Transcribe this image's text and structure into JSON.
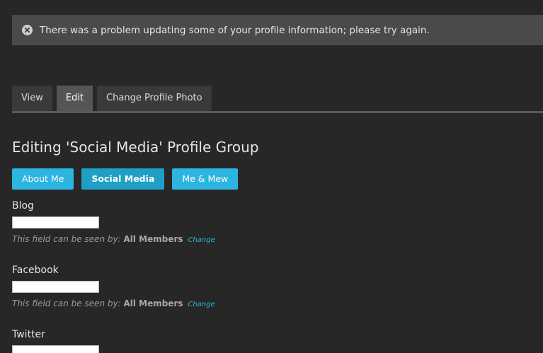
{
  "notice": {
    "message": "There was a problem updating some of your profile information; please try again.",
    "icon": "close-circle-icon"
  },
  "tabs": [
    {
      "label": "View",
      "active": false
    },
    {
      "label": "Edit",
      "active": true
    },
    {
      "label": "Change Profile Photo",
      "active": false
    }
  ],
  "heading": "Editing 'Social Media' Profile Group",
  "groups": [
    {
      "label": "About Me",
      "current": false
    },
    {
      "label": "Social Media",
      "current": true
    },
    {
      "label": "Me & Mew",
      "current": false
    }
  ],
  "fields": [
    {
      "label": "Blog",
      "value": "",
      "visibility_lead": "This field can be seen by:",
      "visibility_level": "All Members",
      "change_label": "Change"
    },
    {
      "label": "Facebook",
      "value": "",
      "visibility_lead": "This field can be seen by:",
      "visibility_level": "All Members",
      "change_label": "Change"
    },
    {
      "label": "Twitter",
      "value": ""
    }
  ],
  "colors": {
    "background": "#272727",
    "accent": "#2bb5e0",
    "notice_bg": "#4a4a4a"
  }
}
